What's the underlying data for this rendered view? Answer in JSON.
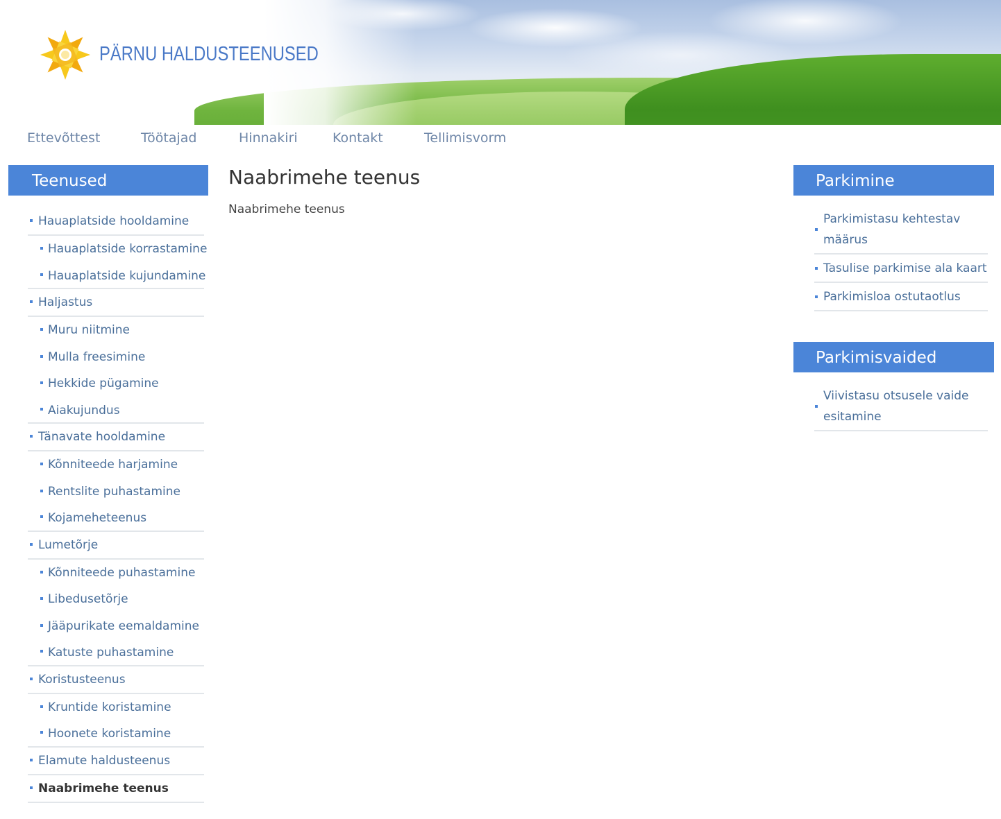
{
  "header": {
    "logo_text": "PÄRNU HALDUSTEENUSED"
  },
  "topnav": [
    {
      "label": "Ettevõttest"
    },
    {
      "label": "Töötajad"
    },
    {
      "label": "Hinnakiri"
    },
    {
      "label": "Kontakt"
    },
    {
      "label": "Tellimisvorm"
    }
  ],
  "left_sidebar": {
    "title": "Teenused",
    "items": [
      {
        "label": "Hauaplatside hooldamine"
      },
      {
        "label": "Hauaplatside korrastamine"
      },
      {
        "label": "Hauaplatside kujundamine"
      },
      {
        "label": "Haljastus"
      },
      {
        "label": "Muru niitmine"
      },
      {
        "label": "Mulla freesimine"
      },
      {
        "label": "Hekkide pügamine"
      },
      {
        "label": "Aiakujundus"
      },
      {
        "label": "Tänavate hooldamine"
      },
      {
        "label": "Kõnniteede harjamine"
      },
      {
        "label": "Rentslite puhastamine"
      },
      {
        "label": "Kojameheteenus"
      },
      {
        "label": "Lumetõrje"
      },
      {
        "label": "Kõnniteede puhastamine"
      },
      {
        "label": "Libedusetõrje"
      },
      {
        "label": "Jääpurikate eemaldamine"
      },
      {
        "label": "Katuste puhastamine"
      },
      {
        "label": "Koristusteenus"
      },
      {
        "label": "Kruntide koristamine"
      },
      {
        "label": "Hoonete koristamine"
      },
      {
        "label": "Elamute haldusteenus"
      },
      {
        "label": "Naabrimehe teenus"
      }
    ]
  },
  "main": {
    "title": "Naabrimehe teenus",
    "body": "Naabrimehe teenus"
  },
  "right_sidebar": {
    "boxes": [
      {
        "title": "Parkimine",
        "items": [
          {
            "label": "Parkimistasu kehtestav määrus"
          },
          {
            "label": "Tasulise parkimise ala kaart"
          },
          {
            "label": "Parkimisloa ostutaotlus"
          }
        ]
      },
      {
        "title": "Parkimisvaided",
        "items": [
          {
            "label": "Viivistasu otsusele vaide esitamine"
          }
        ]
      }
    ]
  },
  "colors": {
    "accent": "#4b85d8",
    "link": "#4a6f9a",
    "nav": "#6f87a8",
    "logo_yellow": "#f5c518"
  },
  "icons": {
    "logo": "sun-star-logo-icon"
  }
}
